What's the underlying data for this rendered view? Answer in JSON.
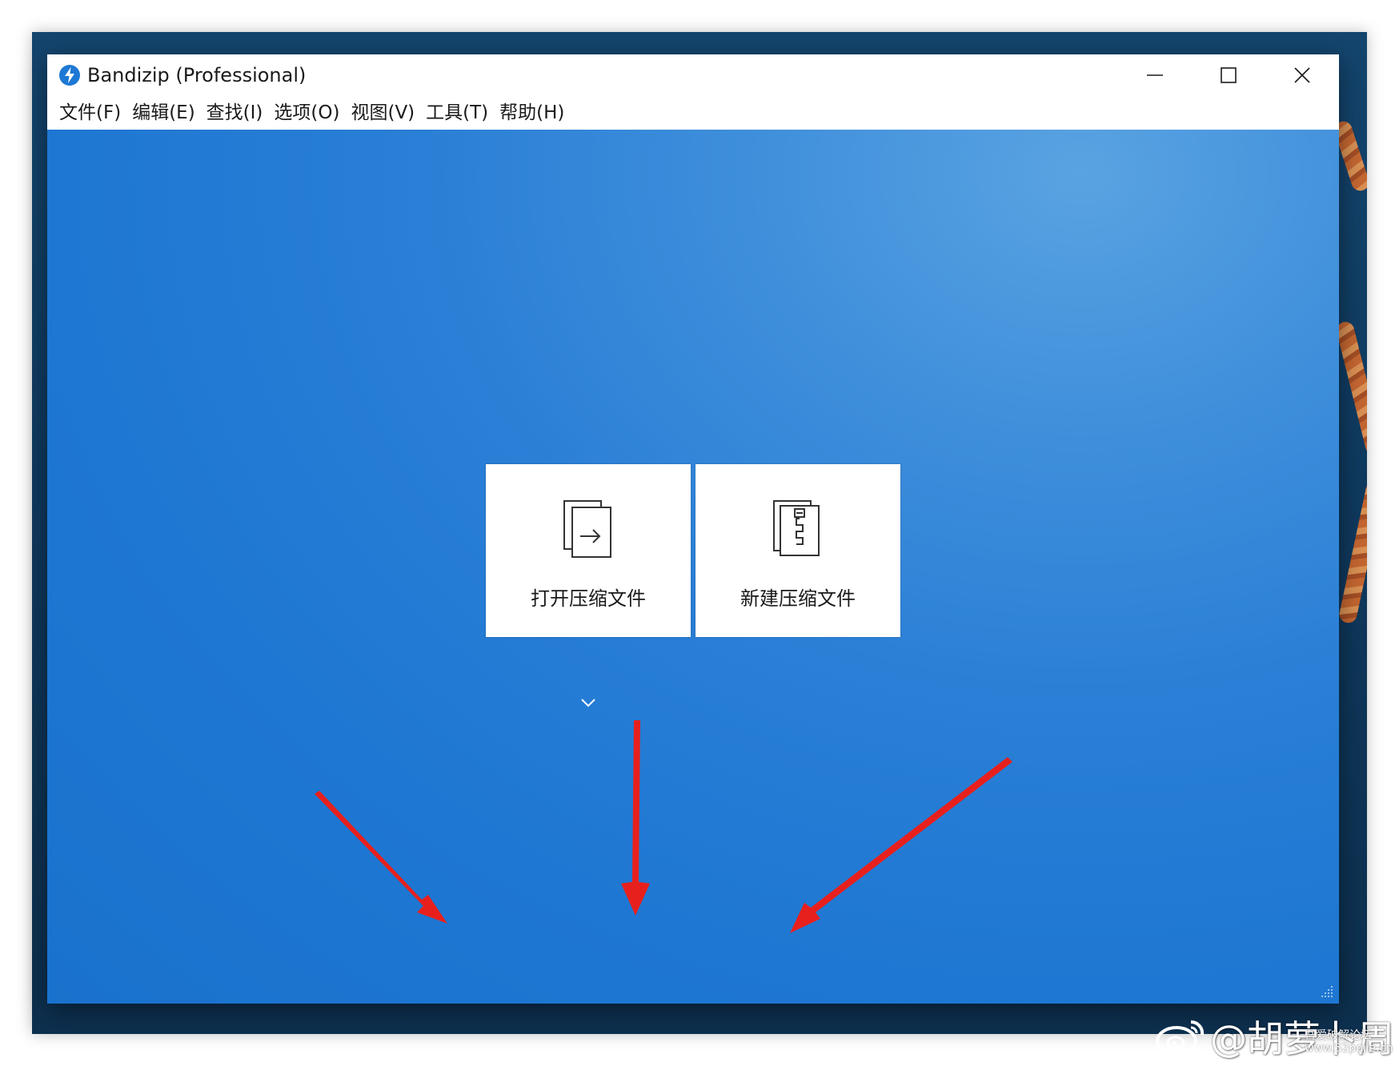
{
  "window": {
    "title": "Bandizip (Professional)",
    "controls": {
      "minimize_icon": "minimize-icon",
      "maximize_icon": "maximize-icon",
      "close_icon": "close-icon"
    }
  },
  "menubar": {
    "items": [
      {
        "label": "文件(F)"
      },
      {
        "label": "编辑(E)"
      },
      {
        "label": "查找(I)"
      },
      {
        "label": "选项(O)"
      },
      {
        "label": "视图(V)"
      },
      {
        "label": "工具(T)"
      },
      {
        "label": "帮助(H)"
      }
    ]
  },
  "main": {
    "tiles": [
      {
        "label": "打开压缩文件",
        "icon": "open-archive-icon"
      },
      {
        "label": "新建压缩文件",
        "icon": "new-archive-icon"
      }
    ],
    "open_dropdown_icon": "chevron-down-icon"
  },
  "annotations": {
    "arrow_icon": "red-arrow-icon",
    "arrow_count": 3
  },
  "watermark": {
    "text": "@胡萝卜周",
    "site_line1": "吾爱破解论坛",
    "site_line2": "www.52pojie.cn"
  },
  "colors": {
    "content_bg": "#1e77d2",
    "content_highlight": "#5aa3e2",
    "tile_bg": "#ffffff",
    "arrow": "#e8201d",
    "app_icon": "#1e78d4"
  }
}
